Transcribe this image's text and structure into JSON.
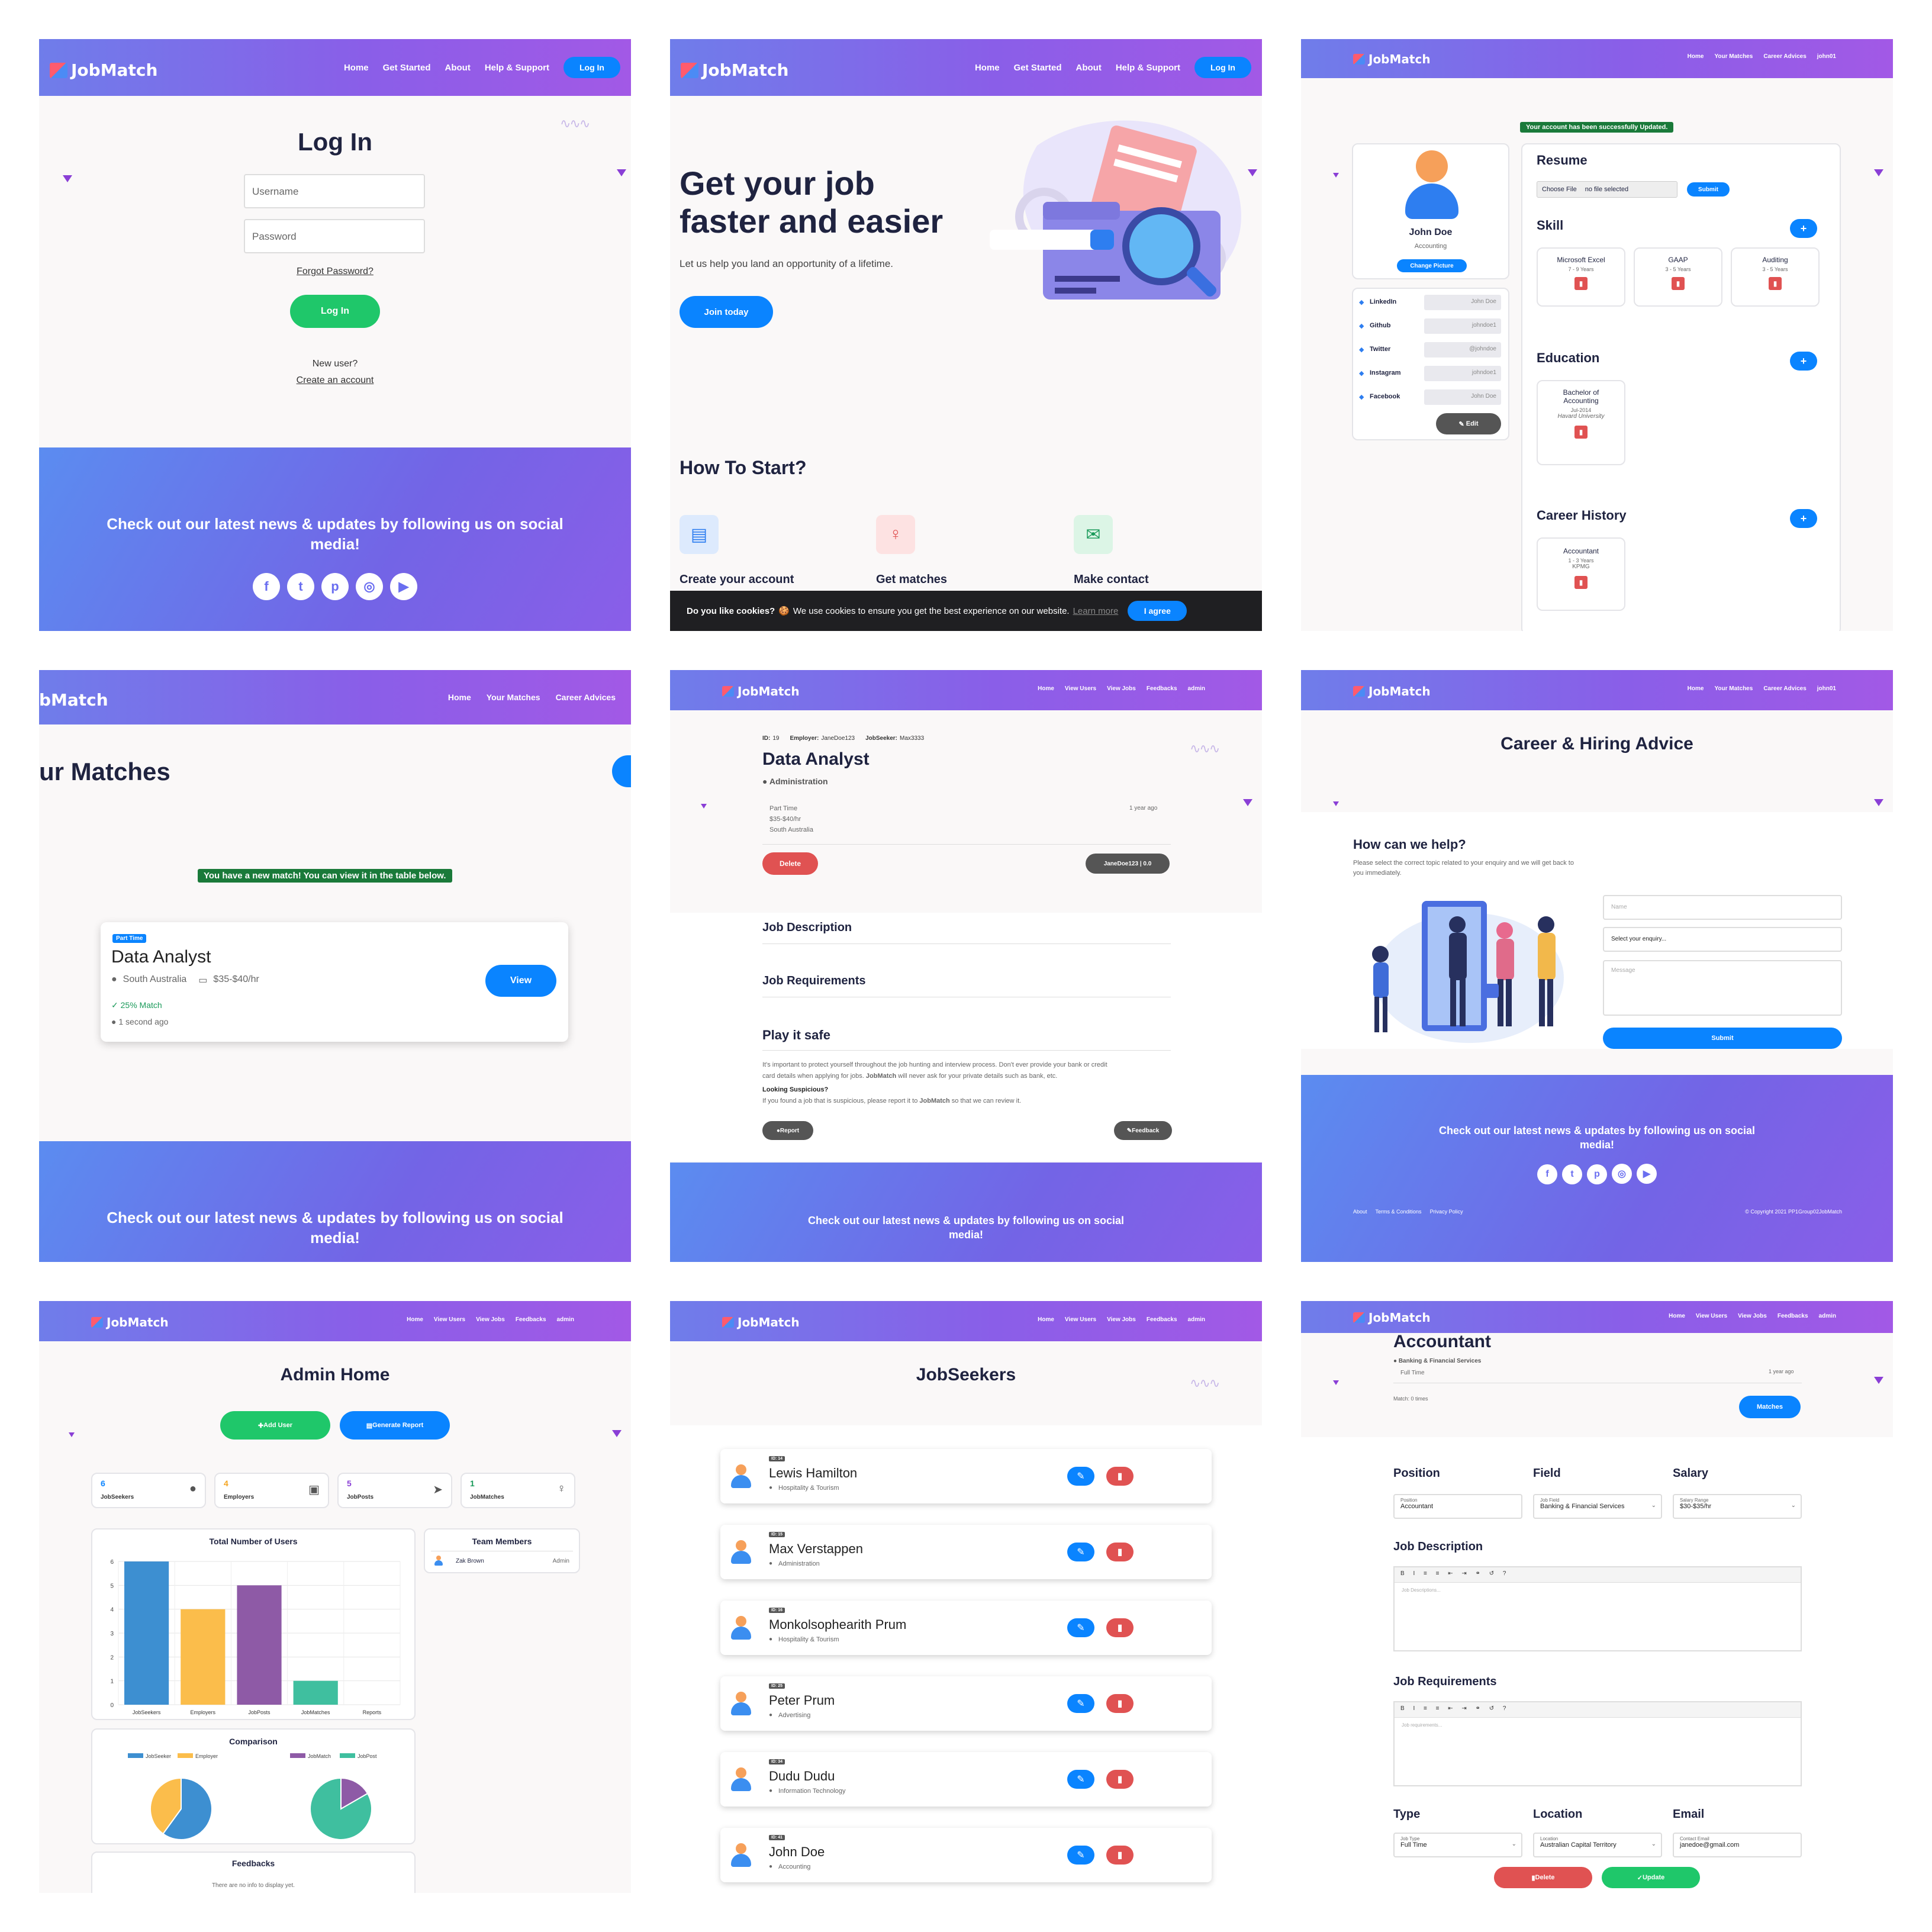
{
  "brand": "JobMatch",
  "t1": {
    "nav": [
      "Home",
      "Get Started",
      "About",
      "Help & Support"
    ],
    "login_btn": "Log In",
    "title": "Log In",
    "username_ph": "Username",
    "password_ph": "Password",
    "forgot": "Forgot Password?",
    "submit": "Log In",
    "new_user": "New user?",
    "create": "Create an account",
    "footer": "Check out our latest news & updates by following us on social media!"
  },
  "t2": {
    "nav": [
      "Home",
      "Get Started",
      "About",
      "Help & Support"
    ],
    "login_btn": "Log In",
    "hero_title_1": "Get your job",
    "hero_title_2": "faster and easier",
    "hero_sub": "Let us help you land an opportunity of a lifetime.",
    "join": "Join today",
    "how": "How To Start?",
    "steps": [
      "Create your account",
      "Get matches",
      "Make contact"
    ],
    "cookie_q": "Do you like cookies?",
    "cookie_text": "We use cookies to ensure you get the best experience on our website.",
    "cookie_learn": "Learn more",
    "cookie_agree": "I agree"
  },
  "t3": {
    "nav": [
      "Home",
      "Your Matches",
      "Career Advices",
      "john01"
    ],
    "alert": "Your account has been successfully Updated.",
    "name": "John Doe",
    "field": "Accounting",
    "change_pic": "Change Picture",
    "socials": [
      {
        "n": "LinkedIn",
        "v": "John Doe"
      },
      {
        "n": "Github",
        "v": "johndoe1"
      },
      {
        "n": "Twitter",
        "v": "@johndoe"
      },
      {
        "n": "Instagram",
        "v": "johndoe1"
      },
      {
        "n": "Facebook",
        "v": "John Doe"
      }
    ],
    "edit": "Edit",
    "resume": "Resume",
    "choose": "Choose File",
    "nofile": "no file selected",
    "submit": "Submit",
    "skill": "Skill",
    "skills": [
      {
        "n": "Microsoft Excel",
        "y": "7 - 9 Years"
      },
      {
        "n": "GAAP",
        "y": "3 - 5 Years"
      },
      {
        "n": "Auditing",
        "y": "3 - 5 Years"
      }
    ],
    "education": "Education",
    "edu_1": "Bachelor of",
    "edu_2": "Accounting",
    "edu_date": "Jul-2014",
    "edu_school": "Havard University",
    "career": "Career History",
    "job": "Accountant",
    "job_years": "1 - 3 Years",
    "job_co": "KPMG"
  },
  "t4": {
    "nav": [
      "Home",
      "Your Matches",
      "Career Advices"
    ],
    "logo_part": "bMatch",
    "title": "ur Matches",
    "alert": "You have a new match! You can view it in the table below.",
    "tag": "Part Time",
    "job": "Data Analyst",
    "loc": "South Australia",
    "salary": "$35-$40/hr",
    "match": "25% Match",
    "time": "1 second ago",
    "view": "View",
    "footer": "Check out our latest news & updates by following us on social media!"
  },
  "t5": {
    "nav": [
      "Home",
      "View Users",
      "View Jobs",
      "Feedbacks",
      "admin"
    ],
    "id_label": "ID:",
    "id": "19",
    "emp_label": "Employer:",
    "emp": "JaneDoe123",
    "seek_label": "JobSeeker:",
    "seek": "Max3333",
    "title": "Data Analyst",
    "category": "Administration",
    "type": "Part Time",
    "salary": "$35-$40/hr",
    "loc": "South Australia",
    "ago": "1 year ago",
    "delete": "Delete",
    "user_chip": "JaneDoe123 | 0.0",
    "desc": "Job Description",
    "req": "Job Requirements",
    "safe": "Play it safe",
    "safe_p1": "It's important to protect yourself throughout the job hunting and interview process. Don't ever provide your bank or credit",
    "safe_p2": "card details when applying for jobs.",
    "safe_p2b": "JobMatch",
    "safe_p2c": "will never ask for your private details such as bank, etc.",
    "susp": "Looking Suspicious?",
    "susp_p": "If you found a job that is suspicious, please report it to",
    "susp_pb": "JobMatch",
    "susp_pc": "so that we can review it.",
    "report": "Report",
    "feedback": "Feedback",
    "footer": "Check out our latest news & updates by following us on social media!"
  },
  "t6": {
    "nav": [
      "Home",
      "Your Matches",
      "Career Advices",
      "john01"
    ],
    "title": "Career & Hiring Advice",
    "help": "How can we help?",
    "help_p": "Please select the correct topic related to your enquiry and we will get back to you immediately.",
    "name_ph": "Name",
    "select": "Select your enquiry...",
    "msg_ph": "Message",
    "submit": "Submit",
    "footer": "Check out our latest news & updates by following us on social media!",
    "links": [
      "About",
      "Terms & Conditions",
      "Privacy Policy"
    ],
    "copy": "© Copyright 2021 PP1Group02JobMatch"
  },
  "t7": {
    "nav": [
      "Home",
      "View Users",
      "View Jobs",
      "Feedbacks",
      "admin"
    ],
    "title": "Admin Home",
    "add": "Add User",
    "report": "Generate Report",
    "stats": [
      {
        "v": "6",
        "l": "JobSeekers",
        "c": "#0a84ff"
      },
      {
        "v": "4",
        "l": "Employers",
        "c": "#f5a623"
      },
      {
        "v": "5",
        "l": "JobPosts",
        "c": "#8a3fd6"
      },
      {
        "v": "1",
        "l": "JobMatches",
        "c": "#1a9a5a"
      }
    ],
    "chart_title": "Total Number of Users",
    "team": "Team Members",
    "member": "Zak Brown",
    "role": "Admin",
    "comparison": "Comparison",
    "legend1": [
      "JobSeeker",
      "Employer"
    ],
    "legend2": [
      "JobMatch",
      "JobPost"
    ],
    "feedbacks": "Feedbacks",
    "nofb": "There are no info to display yet."
  },
  "t8": {
    "nav": [
      "Home",
      "View Users",
      "View Jobs",
      "Feedbacks",
      "admin"
    ],
    "title": "JobSeekers",
    "list": [
      {
        "id": "ID: 14",
        "n": "Lewis Hamilton",
        "f": "Hospitality & Tourism"
      },
      {
        "id": "ID: 15",
        "n": "Max Verstappen",
        "f": "Administration"
      },
      {
        "id": "ID: 16",
        "n": "Monkolsophearith Prum",
        "f": "Hospitality & Tourism"
      },
      {
        "id": "ID: 25",
        "n": "Peter Prum",
        "f": "Advertising"
      },
      {
        "id": "ID: 34",
        "n": "Dudu Dudu",
        "f": "Information Technology"
      },
      {
        "id": "ID: 41",
        "n": "John Doe",
        "f": "Accounting"
      }
    ]
  },
  "t9": {
    "nav": [
      "Home",
      "View Users",
      "View Jobs",
      "Feedbacks",
      "admin"
    ],
    "title": "Accountant",
    "cat": "Banking & Financial Services",
    "type": "Full Time",
    "ago": "1 year ago",
    "matchc": "Match: 0 times",
    "matches": "Matches",
    "position": "Position",
    "field": "Field",
    "salary": "Salary",
    "pos_l": "Position",
    "pos_v": "Accountant",
    "field_l": "Job Field",
    "field_v": "Banking & Financial Services",
    "sal_l": "Salary Range",
    "sal_v": "$30-$35/hr",
    "desc": "Job Description",
    "desc_ph": "Job Descriptions...",
    "req": "Job Requirements",
    "req_ph": "Job requirements...",
    "typeh": "Type",
    "loch": "Location",
    "emailh": "Email",
    "type_l": "Job Type",
    "type_v": "Full Time",
    "loc_l": "Location",
    "loc_v": "Australian Capital Territory",
    "email_l": "Contact Email",
    "email_v": "janedoe@gmail.com",
    "delete": "Delete",
    "update": "Update"
  },
  "chart_data": [
    {
      "type": "bar",
      "title": "Total Number of Users",
      "categories": [
        "JobSeekers",
        "Employers",
        "JobPosts",
        "JobMatches",
        "Reports"
      ],
      "values": [
        6,
        4,
        5,
        1,
        0
      ],
      "ylim": [
        0,
        6
      ],
      "colors": [
        "#3d8fd1",
        "#fbbd4b",
        "#8e5aa6",
        "#3fbf9f",
        "#cccccc"
      ]
    },
    {
      "type": "pie",
      "title": "Comparison",
      "series": [
        {
          "name": "JobSeeker",
          "value": 6
        },
        {
          "name": "Employer",
          "value": 4
        }
      ],
      "colors": [
        "#3d8fd1",
        "#fbbd4b"
      ]
    },
    {
      "type": "pie",
      "title": "Comparison",
      "series": [
        {
          "name": "JobMatch",
          "value": 1
        },
        {
          "name": "JobPost",
          "value": 5
        }
      ],
      "colors": [
        "#8e5aa6",
        "#3fbf9f"
      ]
    }
  ],
  "icons": {
    "check": "check-icon",
    "pin": "location-pin-icon",
    "money": "money-icon",
    "clock": "clock-icon",
    "delete": "trash-icon",
    "edit": "pencil-icon"
  }
}
